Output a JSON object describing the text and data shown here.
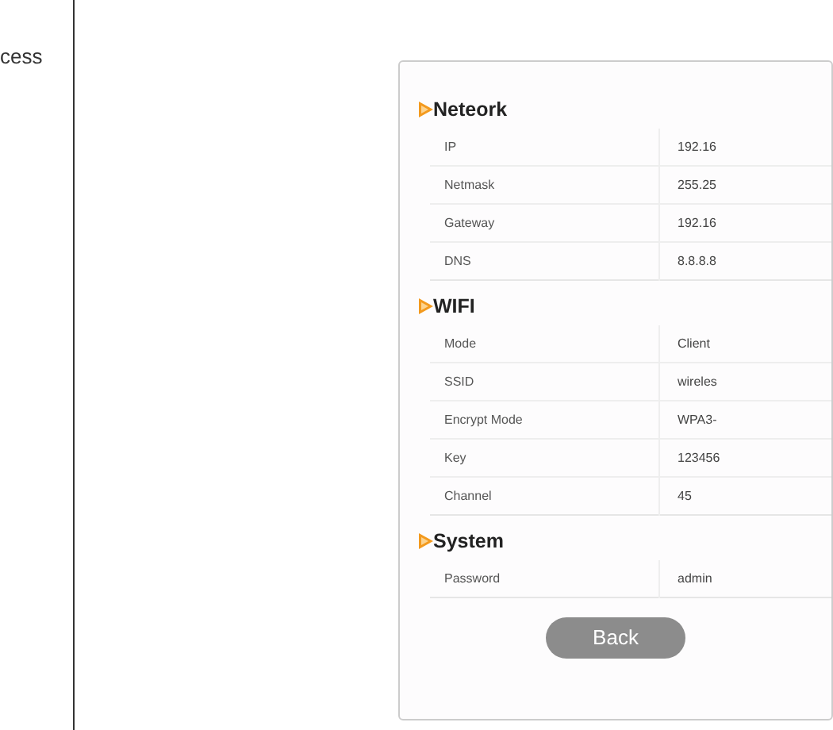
{
  "left_text": "cess",
  "sections": [
    {
      "title": "Neteork",
      "rows": [
        {
          "label": "IP",
          "value": "192.16"
        },
        {
          "label": "Netmask",
          "value": "255.25"
        },
        {
          "label": "Gateway",
          "value": "192.16"
        },
        {
          "label": "DNS",
          "value": "8.8.8.8"
        }
      ]
    },
    {
      "title": "WIFI",
      "rows": [
        {
          "label": "Mode",
          "value": "Client"
        },
        {
          "label": "SSID",
          "value": "wireles"
        },
        {
          "label": "Encrypt Mode",
          "value": "WPA3-"
        },
        {
          "label": "Key",
          "value": "123456"
        },
        {
          "label": "Channel",
          "value": "45"
        }
      ]
    },
    {
      "title": "System",
      "rows": [
        {
          "label": "Password",
          "value": "admin"
        }
      ]
    }
  ],
  "button": "Back"
}
